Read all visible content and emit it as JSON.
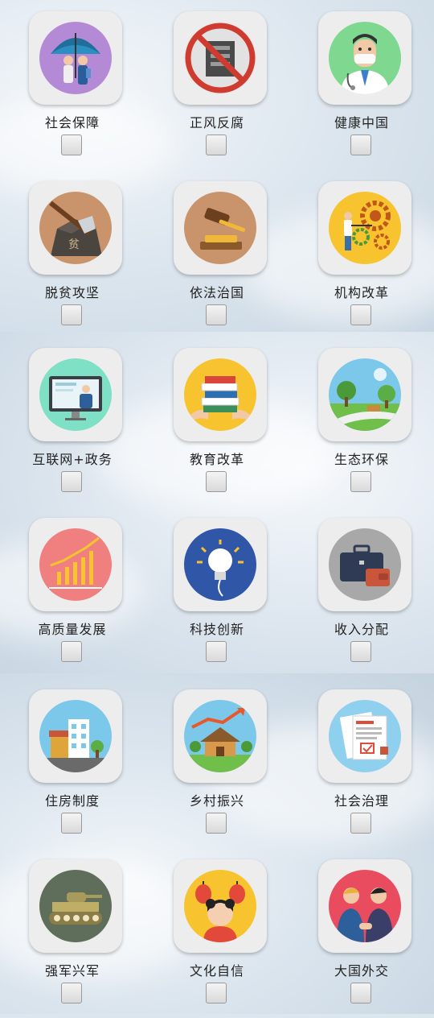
{
  "topics": [
    {
      "label": "社会保障",
      "icon": "umbrella-family-icon",
      "color": "#b48ad6",
      "checked": false
    },
    {
      "label": "正风反腐",
      "icon": "anti-corruption-icon",
      "color": "#e8e8e8",
      "checked": false
    },
    {
      "label": "健康中国",
      "icon": "doctor-icon",
      "color": "#7fd88f",
      "checked": false
    },
    {
      "label": "脱贫攻坚",
      "icon": "axe-rock-icon",
      "color": "#c9936b",
      "checked": false
    },
    {
      "label": "依法治国",
      "icon": "gavel-icon",
      "color": "#c9936b",
      "checked": false
    },
    {
      "label": "机构改革",
      "icon": "gears-icon",
      "color": "#f7c32e",
      "checked": false
    },
    {
      "label": "互联网+政务",
      "icon": "computer-monitor-icon",
      "color": "#7ee0c4",
      "checked": false
    },
    {
      "label": "教育改革",
      "icon": "books-icon",
      "color": "#f7c32e",
      "checked": false
    },
    {
      "label": "生态环保",
      "icon": "landscape-icon",
      "color": "#7cc8ea",
      "checked": false
    },
    {
      "label": "高质量发展",
      "icon": "growth-chart-icon",
      "color": "#f07f7f",
      "checked": false
    },
    {
      "label": "科技创新",
      "icon": "light-bulb-icon",
      "color": "#3056a8",
      "checked": false
    },
    {
      "label": "收入分配",
      "icon": "briefcase-wallet-icon",
      "color": "#a8a8a8",
      "checked": false
    },
    {
      "label": "住房制度",
      "icon": "buildings-icon",
      "color": "#7cc8ea",
      "checked": false
    },
    {
      "label": "乡村振兴",
      "icon": "village-house-icon",
      "color": "#7cc8ea",
      "checked": false
    },
    {
      "label": "社会治理",
      "icon": "documents-stamp-icon",
      "color": "#8fd0ef",
      "checked": false
    },
    {
      "label": "强军兴军",
      "icon": "tank-icon",
      "color": "#5f6e5a",
      "checked": false
    },
    {
      "label": "文化自信",
      "icon": "lanterns-girl-icon",
      "color": "#f7c32e",
      "checked": false
    },
    {
      "label": "大国外交",
      "icon": "handshake-icon",
      "color": "#e94b5f",
      "checked": false
    }
  ]
}
